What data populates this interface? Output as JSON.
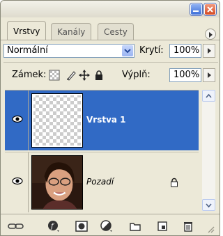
{
  "window": {
    "buttons": [
      "minimize",
      "close"
    ]
  },
  "tabs": [
    {
      "label": "Vrstvy",
      "active": true
    },
    {
      "label": "Kanály",
      "active": false
    },
    {
      "label": "Cesty",
      "active": false
    }
  ],
  "blend": {
    "mode": "Normální",
    "opacity_label": "Krytí:",
    "opacity": "100%"
  },
  "lock": {
    "label": "Zámek:",
    "fill_label": "Výplň:",
    "fill": "100%",
    "icons": [
      "lock-transparency-icon",
      "lock-image-icon",
      "lock-position-icon",
      "lock-all-icon"
    ]
  },
  "layers": [
    {
      "name": "Vrstva 1",
      "selected": true,
      "visible": true,
      "thumbnail": "transparent-checkerboard"
    },
    {
      "name": "Pozadí",
      "selected": false,
      "visible": true,
      "locked": true,
      "thumbnail": "portrait-photo"
    }
  ],
  "toolbar": {
    "icons": [
      "link-layers-icon",
      "layer-style-icon",
      "layer-mask-icon",
      "adjustment-layer-icon",
      "new-group-icon",
      "new-layer-icon",
      "delete-layer-icon"
    ]
  },
  "colors": {
    "selection": "#316ac5",
    "panel": "#ece9d8"
  }
}
